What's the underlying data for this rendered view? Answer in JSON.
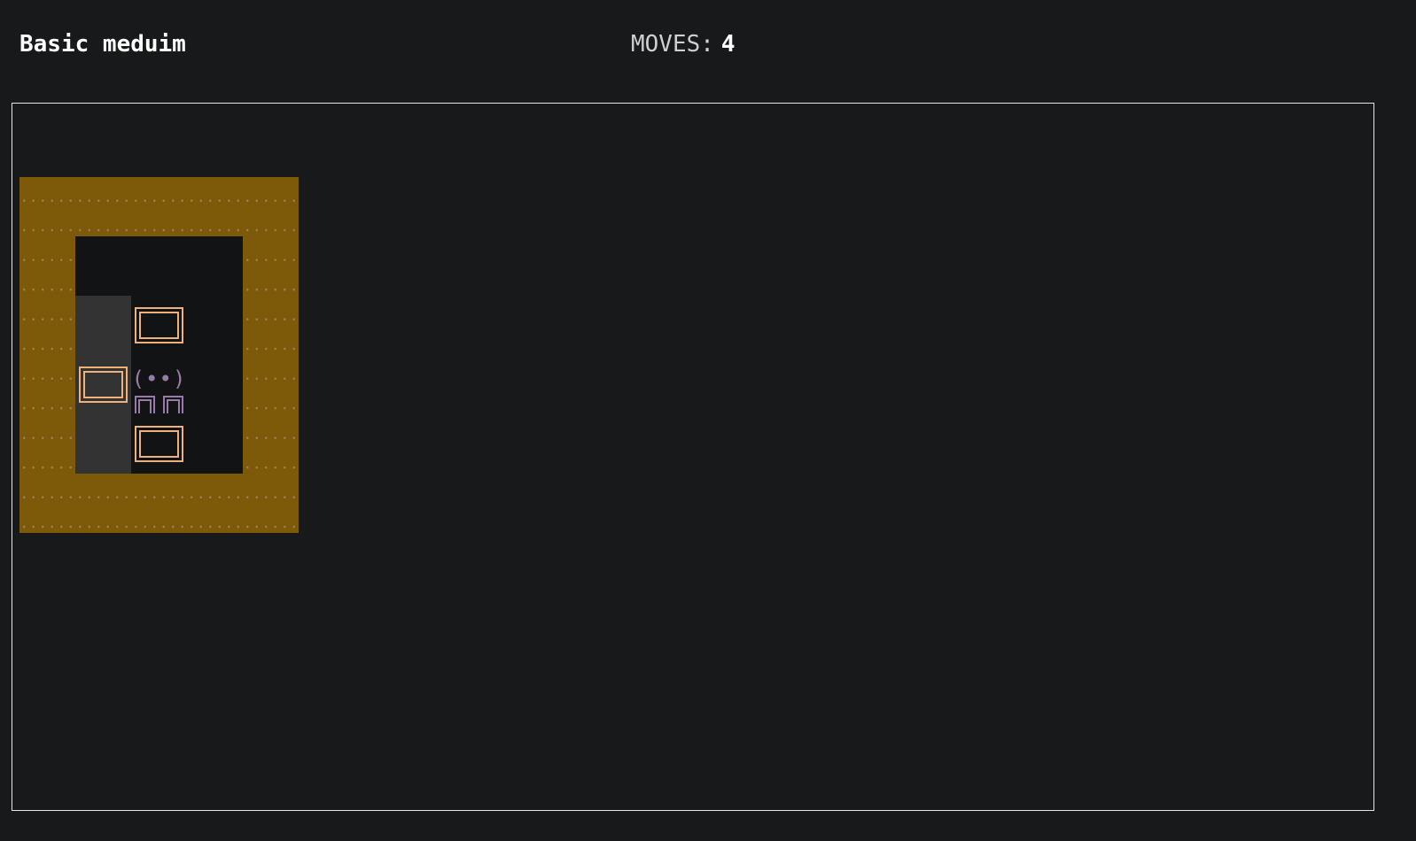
{
  "header": {
    "level_name": "Basic meduim",
    "moves_label": "MOVES:",
    "moves_value": "4"
  },
  "level": {
    "rows": 6,
    "cols": 5,
    "map": [
      "#####",
      "#   #",
      "#.$ #",
      "#*@ #",
      "#.$ #",
      "#####"
    ]
  },
  "player": {
    "head": "(••)"
  },
  "colors": {
    "background": "#18191b",
    "wall": "#7d5a0a",
    "floor": "#121314",
    "goal": "#333334",
    "box": "#f0b07a",
    "player": "#9a7aa8"
  }
}
